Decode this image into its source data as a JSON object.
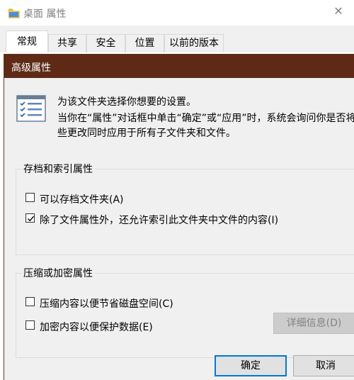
{
  "properties_window": {
    "title": "桌面 属性",
    "close_glyph": "✕",
    "tabs": [
      {
        "label": "常规",
        "active": true
      },
      {
        "label": "共享",
        "active": false
      },
      {
        "label": "安全",
        "active": false
      },
      {
        "label": "位置",
        "active": false
      },
      {
        "label": "以前的版本",
        "active": false
      }
    ]
  },
  "advanced_dialog": {
    "title": "高级属性",
    "description_line1": "为该文件夹选择你想要的设置。",
    "description_line2": "当你在“属性”对话框中单击“确定”或“应用”时，系统会询问你是否将这",
    "description_line3": "些更改同时应用于所有子文件夹和文件。",
    "archive_index_group": {
      "label": "存档和索引属性",
      "options": [
        {
          "label": "可以存档文件夹(A)",
          "checked": false
        },
        {
          "label": "除了文件属性外，还允许索引此文件夹中文件的内容(I)",
          "checked": true
        }
      ]
    },
    "compress_encrypt_group": {
      "label": "压缩或加密属性",
      "options": [
        {
          "label": "压缩内容以便节省磁盘空间(C)",
          "checked": false
        },
        {
          "label": "加密内容以便保护数据(E)",
          "checked": false
        }
      ],
      "details_button": "详细信息(D)"
    },
    "buttons": {
      "ok": "确定",
      "cancel": "取消"
    }
  },
  "colors": {
    "active_titlebar": "#5e2a16",
    "dialog_bg": "#f0f0f0",
    "default_button_border": "#0078d7"
  }
}
